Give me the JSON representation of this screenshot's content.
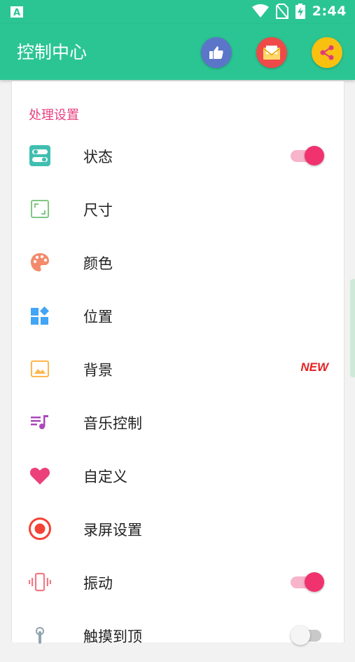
{
  "status_bar": {
    "time": "2:44",
    "icons": [
      "a-notification-icon",
      "wifi-icon",
      "no-sim-icon",
      "battery-charging-icon"
    ]
  },
  "app_bar": {
    "title": "控制中心",
    "actions": [
      {
        "name": "thumbs-up-icon",
        "color": "#5b76c8"
      },
      {
        "name": "mail-icon",
        "color": "#ee4a4a"
      },
      {
        "name": "share-icon",
        "color": "#f8c110"
      }
    ],
    "color": "#2bc593"
  },
  "settings": {
    "section_title": "处理设置",
    "items": [
      {
        "label": "状态",
        "icon": "toggle-panel-icon",
        "toggle": "on"
      },
      {
        "label": "尺寸",
        "icon": "aspect-ratio-icon"
      },
      {
        "label": "颜色",
        "icon": "palette-icon"
      },
      {
        "label": "位置",
        "icon": "widgets-icon"
      },
      {
        "label": "背景",
        "icon": "image-icon",
        "badge": "NEW"
      },
      {
        "label": "音乐控制",
        "icon": "queue-music-icon"
      },
      {
        "label": "自定义",
        "icon": "heart-icon"
      },
      {
        "label": "录屏设置",
        "icon": "record-icon"
      },
      {
        "label": "振动",
        "icon": "vibration-icon",
        "toggle": "on"
      },
      {
        "label": "触摸到顶",
        "icon": "touch-icon",
        "toggle": "off"
      }
    ]
  }
}
